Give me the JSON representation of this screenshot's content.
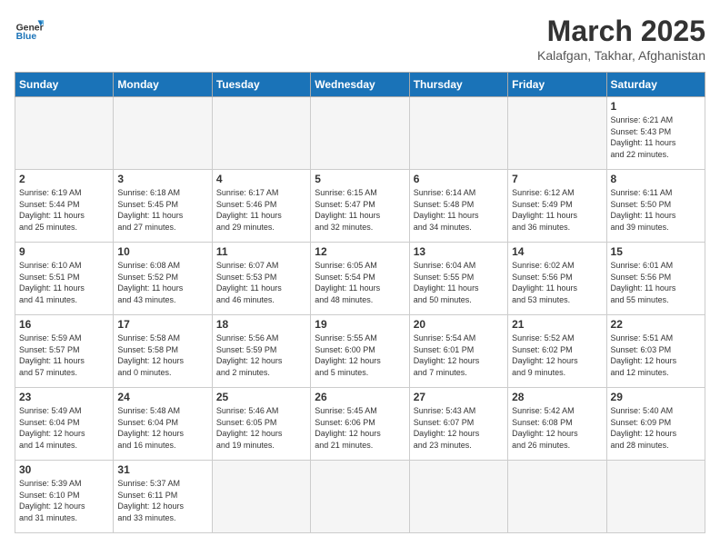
{
  "logo": {
    "text_general": "General",
    "text_blue": "Blue"
  },
  "title": "March 2025",
  "subtitle": "Kalafgan, Takhar, Afghanistan",
  "weekdays": [
    "Sunday",
    "Monday",
    "Tuesday",
    "Wednesday",
    "Thursday",
    "Friday",
    "Saturday"
  ],
  "weeks": [
    [
      {
        "day": "",
        "info": ""
      },
      {
        "day": "",
        "info": ""
      },
      {
        "day": "",
        "info": ""
      },
      {
        "day": "",
        "info": ""
      },
      {
        "day": "",
        "info": ""
      },
      {
        "day": "",
        "info": ""
      },
      {
        "day": "1",
        "info": "Sunrise: 6:21 AM\nSunset: 5:43 PM\nDaylight: 11 hours\nand 22 minutes."
      }
    ],
    [
      {
        "day": "2",
        "info": "Sunrise: 6:19 AM\nSunset: 5:44 PM\nDaylight: 11 hours\nand 25 minutes."
      },
      {
        "day": "3",
        "info": "Sunrise: 6:18 AM\nSunset: 5:45 PM\nDaylight: 11 hours\nand 27 minutes."
      },
      {
        "day": "4",
        "info": "Sunrise: 6:17 AM\nSunset: 5:46 PM\nDaylight: 11 hours\nand 29 minutes."
      },
      {
        "day": "5",
        "info": "Sunrise: 6:15 AM\nSunset: 5:47 PM\nDaylight: 11 hours\nand 32 minutes."
      },
      {
        "day": "6",
        "info": "Sunrise: 6:14 AM\nSunset: 5:48 PM\nDaylight: 11 hours\nand 34 minutes."
      },
      {
        "day": "7",
        "info": "Sunrise: 6:12 AM\nSunset: 5:49 PM\nDaylight: 11 hours\nand 36 minutes."
      },
      {
        "day": "8",
        "info": "Sunrise: 6:11 AM\nSunset: 5:50 PM\nDaylight: 11 hours\nand 39 minutes."
      }
    ],
    [
      {
        "day": "9",
        "info": "Sunrise: 6:10 AM\nSunset: 5:51 PM\nDaylight: 11 hours\nand 41 minutes."
      },
      {
        "day": "10",
        "info": "Sunrise: 6:08 AM\nSunset: 5:52 PM\nDaylight: 11 hours\nand 43 minutes."
      },
      {
        "day": "11",
        "info": "Sunrise: 6:07 AM\nSunset: 5:53 PM\nDaylight: 11 hours\nand 46 minutes."
      },
      {
        "day": "12",
        "info": "Sunrise: 6:05 AM\nSunset: 5:54 PM\nDaylight: 11 hours\nand 48 minutes."
      },
      {
        "day": "13",
        "info": "Sunrise: 6:04 AM\nSunset: 5:55 PM\nDaylight: 11 hours\nand 50 minutes."
      },
      {
        "day": "14",
        "info": "Sunrise: 6:02 AM\nSunset: 5:56 PM\nDaylight: 11 hours\nand 53 minutes."
      },
      {
        "day": "15",
        "info": "Sunrise: 6:01 AM\nSunset: 5:56 PM\nDaylight: 11 hours\nand 55 minutes."
      }
    ],
    [
      {
        "day": "16",
        "info": "Sunrise: 5:59 AM\nSunset: 5:57 PM\nDaylight: 11 hours\nand 57 minutes."
      },
      {
        "day": "17",
        "info": "Sunrise: 5:58 AM\nSunset: 5:58 PM\nDaylight: 12 hours\nand 0 minutes."
      },
      {
        "day": "18",
        "info": "Sunrise: 5:56 AM\nSunset: 5:59 PM\nDaylight: 12 hours\nand 2 minutes."
      },
      {
        "day": "19",
        "info": "Sunrise: 5:55 AM\nSunset: 6:00 PM\nDaylight: 12 hours\nand 5 minutes."
      },
      {
        "day": "20",
        "info": "Sunrise: 5:54 AM\nSunset: 6:01 PM\nDaylight: 12 hours\nand 7 minutes."
      },
      {
        "day": "21",
        "info": "Sunrise: 5:52 AM\nSunset: 6:02 PM\nDaylight: 12 hours\nand 9 minutes."
      },
      {
        "day": "22",
        "info": "Sunrise: 5:51 AM\nSunset: 6:03 PM\nDaylight: 12 hours\nand 12 minutes."
      }
    ],
    [
      {
        "day": "23",
        "info": "Sunrise: 5:49 AM\nSunset: 6:04 PM\nDaylight: 12 hours\nand 14 minutes."
      },
      {
        "day": "24",
        "info": "Sunrise: 5:48 AM\nSunset: 6:04 PM\nDaylight: 12 hours\nand 16 minutes."
      },
      {
        "day": "25",
        "info": "Sunrise: 5:46 AM\nSunset: 6:05 PM\nDaylight: 12 hours\nand 19 minutes."
      },
      {
        "day": "26",
        "info": "Sunrise: 5:45 AM\nSunset: 6:06 PM\nDaylight: 12 hours\nand 21 minutes."
      },
      {
        "day": "27",
        "info": "Sunrise: 5:43 AM\nSunset: 6:07 PM\nDaylight: 12 hours\nand 23 minutes."
      },
      {
        "day": "28",
        "info": "Sunrise: 5:42 AM\nSunset: 6:08 PM\nDaylight: 12 hours\nand 26 minutes."
      },
      {
        "day": "29",
        "info": "Sunrise: 5:40 AM\nSunset: 6:09 PM\nDaylight: 12 hours\nand 28 minutes."
      }
    ],
    [
      {
        "day": "30",
        "info": "Sunrise: 5:39 AM\nSunset: 6:10 PM\nDaylight: 12 hours\nand 31 minutes."
      },
      {
        "day": "31",
        "info": "Sunrise: 5:37 AM\nSunset: 6:11 PM\nDaylight: 12 hours\nand 33 minutes."
      },
      {
        "day": "",
        "info": ""
      },
      {
        "day": "",
        "info": ""
      },
      {
        "day": "",
        "info": ""
      },
      {
        "day": "",
        "info": ""
      },
      {
        "day": "",
        "info": ""
      }
    ]
  ]
}
